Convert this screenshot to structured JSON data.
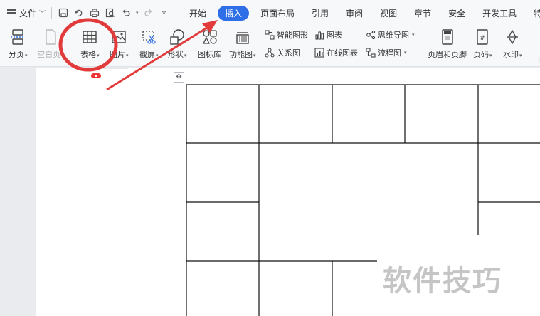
{
  "menubar": {
    "file_label": "文件",
    "quick_icons": [
      "save-icon",
      "undo-history-icon",
      "print-icon",
      "print-preview-icon",
      "undo-icon",
      "redo-icon",
      "customize-icon"
    ],
    "tabs": [
      {
        "label": "开始",
        "active": false
      },
      {
        "label": "插入",
        "active": true
      },
      {
        "label": "页面布局",
        "active": false
      },
      {
        "label": "引用",
        "active": false
      },
      {
        "label": "审阅",
        "active": false
      },
      {
        "label": "视图",
        "active": false
      },
      {
        "label": "章节",
        "active": false
      },
      {
        "label": "安全",
        "active": false
      },
      {
        "label": "开发工具",
        "active": false
      },
      {
        "label": "特色应",
        "active": false
      }
    ]
  },
  "ribbon": {
    "page_break": "分页",
    "blank_page": "空白页",
    "table": "表格",
    "picture": "图片",
    "screenshot": "截屏",
    "shape": "形状",
    "icon_library": "图标库",
    "function_chart": "功能图",
    "smart_graphic": "智能图形",
    "chart": "图表",
    "relation_chart": "关系图",
    "online_chart": "在线图表",
    "mind_map": "思维导图",
    "flowchart": "流程图",
    "header_footer": "页眉和页脚",
    "page_number": "页码",
    "watermark": "水印"
  },
  "annotation": {
    "circle_color": "#e23b3b",
    "arrow_color": "#e23b3b"
  },
  "document": {
    "watermark_text": "软件技巧"
  },
  "colors": {
    "accent": "#2e6ee6",
    "ribbon_bg": "#f7f8fa"
  }
}
